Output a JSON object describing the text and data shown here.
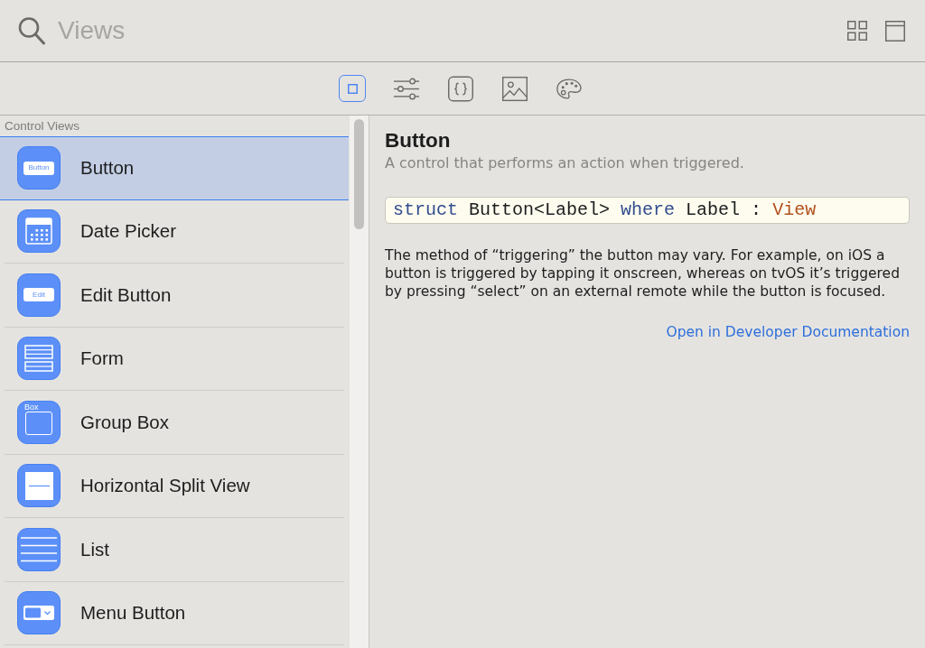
{
  "search": {
    "placeholder": "Views"
  },
  "category_tabs": [
    {
      "kind": "square",
      "selected": true
    },
    {
      "kind": "sliders",
      "selected": false
    },
    {
      "kind": "braces",
      "selected": false
    },
    {
      "kind": "image",
      "selected": false
    },
    {
      "kind": "palette",
      "selected": false
    }
  ],
  "library": {
    "section_title": "Control Views",
    "items": [
      {
        "label": "Button",
        "kind": "button",
        "icon_text": "Button",
        "selected": true
      },
      {
        "label": "Date Picker",
        "kind": "calendar",
        "selected": false
      },
      {
        "label": "Edit Button",
        "kind": "button",
        "icon_text": "Edit",
        "selected": false
      },
      {
        "label": "Form",
        "kind": "form",
        "selected": false
      },
      {
        "label": "Group Box",
        "kind": "group_box",
        "icon_text": "Box",
        "selected": false
      },
      {
        "label": "Horizontal Split View",
        "kind": "split",
        "selected": false
      },
      {
        "label": "List",
        "kind": "list",
        "selected": false
      },
      {
        "label": "Menu Button",
        "kind": "menu",
        "selected": false
      }
    ]
  },
  "detail": {
    "title": "Button",
    "summary": "A control that performs an action when triggered.",
    "declaration": [
      {
        "text": "struct",
        "kind": "keyword"
      },
      {
        "text": "Button<Label>",
        "kind": "plain"
      },
      {
        "text": "where",
        "kind": "keyword"
      },
      {
        "text": "Label :",
        "kind": "plain"
      },
      {
        "text": "View",
        "kind": "type"
      }
    ],
    "discussion": "The method of “triggering” the button may vary. For example, on iOS a button is triggered by tapping it onscreen, whereas on tvOS it’s triggered by pressing “select” on an external remote while the button is focused.",
    "link": "Open in Developer Documentation"
  }
}
